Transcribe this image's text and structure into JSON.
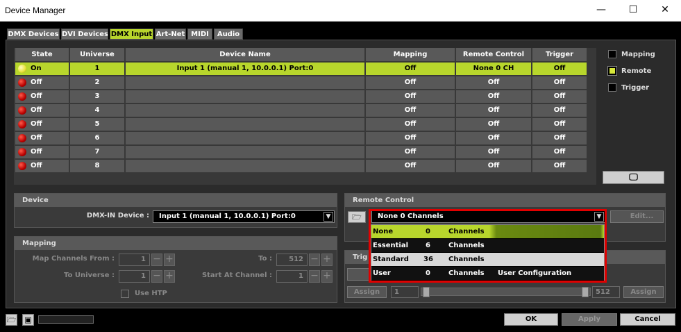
{
  "window": {
    "title": "Device Manager",
    "min_glyph": "—",
    "max_glyph": "☐",
    "close_glyph": "✕"
  },
  "tabs": [
    {
      "label": "DMX Devices",
      "active": false
    },
    {
      "label": "DVI Devices",
      "active": false
    },
    {
      "label": "DMX Input",
      "active": true
    },
    {
      "label": "Art-Net",
      "active": false
    },
    {
      "label": "MIDI",
      "active": false
    },
    {
      "label": "Audio",
      "active": false
    }
  ],
  "table": {
    "headers": [
      "State",
      "Universe",
      "Device Name",
      "Mapping",
      "Remote Control",
      "Trigger"
    ],
    "rows": [
      {
        "state": "On",
        "universe": "1",
        "device": "Input 1 (manual 1, 10.0.0.1) Port:0",
        "mapping": "Off",
        "remote": "None  0 CH",
        "trigger": "Off",
        "selected": true
      },
      {
        "state": "Off",
        "universe": "2",
        "device": "",
        "mapping": "Off",
        "remote": "Off",
        "trigger": "Off",
        "selected": false
      },
      {
        "state": "Off",
        "universe": "3",
        "device": "",
        "mapping": "Off",
        "remote": "Off",
        "trigger": "Off",
        "selected": false
      },
      {
        "state": "Off",
        "universe": "4",
        "device": "",
        "mapping": "Off",
        "remote": "Off",
        "trigger": "Off",
        "selected": false
      },
      {
        "state": "Off",
        "universe": "5",
        "device": "",
        "mapping": "Off",
        "remote": "Off",
        "trigger": "Off",
        "selected": false
      },
      {
        "state": "Off",
        "universe": "6",
        "device": "",
        "mapping": "Off",
        "remote": "Off",
        "trigger": "Off",
        "selected": false
      },
      {
        "state": "Off",
        "universe": "7",
        "device": "",
        "mapping": "Off",
        "remote": "Off",
        "trigger": "Off",
        "selected": false
      },
      {
        "state": "Off",
        "universe": "8",
        "device": "",
        "mapping": "Off",
        "remote": "Off",
        "trigger": "Off",
        "selected": false
      }
    ]
  },
  "legend": {
    "mapping": "Mapping",
    "remote": "Remote",
    "trigger": "Trigger"
  },
  "device": {
    "header": "Device",
    "label": "DMX-IN Device :",
    "value": "Input 1 (manual 1, 10.0.0.1) Port:0"
  },
  "mapping": {
    "header": "Mapping",
    "map_from_label": "Map Channels From :",
    "map_from_value": "1",
    "to_label": "To :",
    "to_value": "512",
    "to_universe_label": "To Universe :",
    "to_universe_value": "1",
    "start_channel_label": "Start At Channel :",
    "start_channel_value": "1",
    "use_htp": "Use HTP"
  },
  "remote_control": {
    "header": "Remote Control",
    "selected": "None   0 Channels",
    "edit": "Edit...",
    "options": [
      {
        "name": "None",
        "count": "0",
        "unit": "Channels",
        "extra": ""
      },
      {
        "name": "Essential",
        "count": "6",
        "unit": "Channels",
        "extra": ""
      },
      {
        "name": "Standard",
        "count": "36",
        "unit": "Channels",
        "extra": ""
      },
      {
        "name": "User",
        "count": "0",
        "unit": "Channels",
        "extra": "User Configuration"
      }
    ]
  },
  "trigger": {
    "header": "Trig",
    "assign": "Assign",
    "from": "1",
    "to": "512",
    "assign2": "Assign"
  },
  "footer": {
    "ok": "OK",
    "apply": "Apply",
    "cancel": "Cancel",
    "monitor_glyph": "🖵"
  }
}
